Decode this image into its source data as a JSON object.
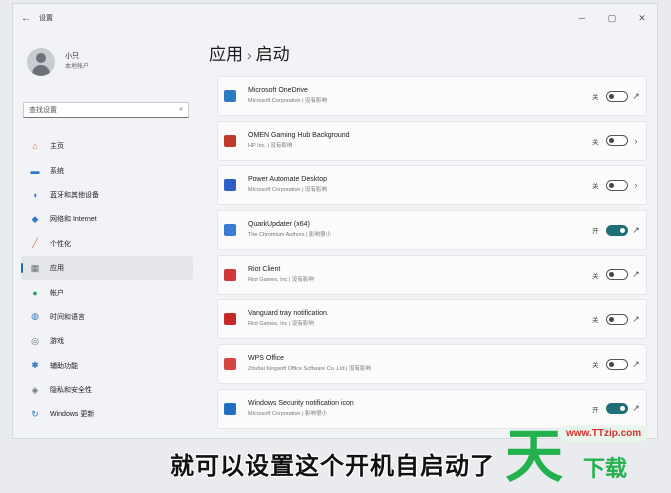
{
  "window": {
    "title": "设置"
  },
  "user": {
    "name": "小只",
    "account": "本地帐户"
  },
  "search": {
    "placeholder": "查找设置"
  },
  "nav": [
    {
      "label": "主页",
      "icon": "home-icon",
      "glyph": "⌂",
      "color": "#e06c3c",
      "active": false
    },
    {
      "label": "系统",
      "icon": "display-icon",
      "glyph": "▬",
      "color": "#2f78c4",
      "active": false
    },
    {
      "label": "蓝牙和其他设备",
      "icon": "bluetooth-icon",
      "glyph": "◖",
      "color": "#2f78c4",
      "active": false
    },
    {
      "label": "网络和 Internet",
      "icon": "wifi-icon",
      "glyph": "◆",
      "color": "#2f78c4",
      "active": false
    },
    {
      "label": "个性化",
      "icon": "brush-icon",
      "glyph": "╱",
      "color": "#d87c3e",
      "active": false
    },
    {
      "label": "应用",
      "icon": "apps-icon",
      "glyph": "▦",
      "color": "#6a6f76",
      "active": true
    },
    {
      "label": "帐户",
      "icon": "person-icon",
      "glyph": "●",
      "color": "#2ba36a",
      "active": false
    },
    {
      "label": "时间和语言",
      "icon": "globe-icon",
      "glyph": "◍",
      "color": "#2f78c4",
      "active": false
    },
    {
      "label": "游戏",
      "icon": "gamepad-icon",
      "glyph": "◎",
      "color": "#6a6f76",
      "active": false
    },
    {
      "label": "辅助功能",
      "icon": "accessibility-icon",
      "glyph": "✱",
      "color": "#2f78c4",
      "active": false
    },
    {
      "label": "隐私和安全性",
      "icon": "shield-icon",
      "glyph": "◈",
      "color": "#6a6f76",
      "active": false
    },
    {
      "label": "Windows 更新",
      "icon": "update-icon",
      "glyph": "↻",
      "color": "#2f78c4",
      "active": false
    }
  ],
  "breadcrumb": {
    "parent": "应用",
    "separator": "›",
    "current": "启动"
  },
  "apps": [
    {
      "name": "Microsoft OneDrive",
      "publisher": "Microsoft Corporation  |  没有影响",
      "state": "关",
      "on": false,
      "end": "↗",
      "icon_color": "#2f78c4"
    },
    {
      "name": "OMEN Gaming Hub Background",
      "publisher": "HP Inc.  |  没有影响",
      "state": "关",
      "on": false,
      "end": "›",
      "icon_color": "#c0392b"
    },
    {
      "name": "Power Automate Desktop",
      "publisher": "Microsoft Corporation  |  没有影响",
      "state": "关",
      "on": false,
      "end": "›",
      "icon_color": "#2c5ec4"
    },
    {
      "name": "QuarkUpdater (x64)",
      "publisher": "The Chromium Authors  |  影响很小",
      "state": "开",
      "on": true,
      "end": "↗",
      "icon_color": "#3a7bd5"
    },
    {
      "name": "Riot Client",
      "publisher": "Riot Games, Inc  |  没有影响",
      "state": "关",
      "on": false,
      "end": "↗",
      "icon_color": "#d13639"
    },
    {
      "name": "Vanguard tray notification.",
      "publisher": "Riot Games, Inc  |  没有影响",
      "state": "关",
      "on": false,
      "end": "↗",
      "icon_color": "#c62828"
    },
    {
      "name": "WPS Office",
      "publisher": "Zhuhai Kingsoft Office Software Co.,Ltd  |  没有影响",
      "state": "关",
      "on": false,
      "end": "↗",
      "icon_color": "#d64541"
    },
    {
      "name": "Windows Security notification icon",
      "publisher": "Microsoft Corporation  |  影响很小",
      "state": "开",
      "on": true,
      "end": "↗",
      "icon_color": "#1f6fc5"
    }
  ],
  "caption": "就可以设置这个开机自启动了",
  "watermark": {
    "big": "天",
    "url": "www.TTzip.com",
    "tail": "下载"
  }
}
